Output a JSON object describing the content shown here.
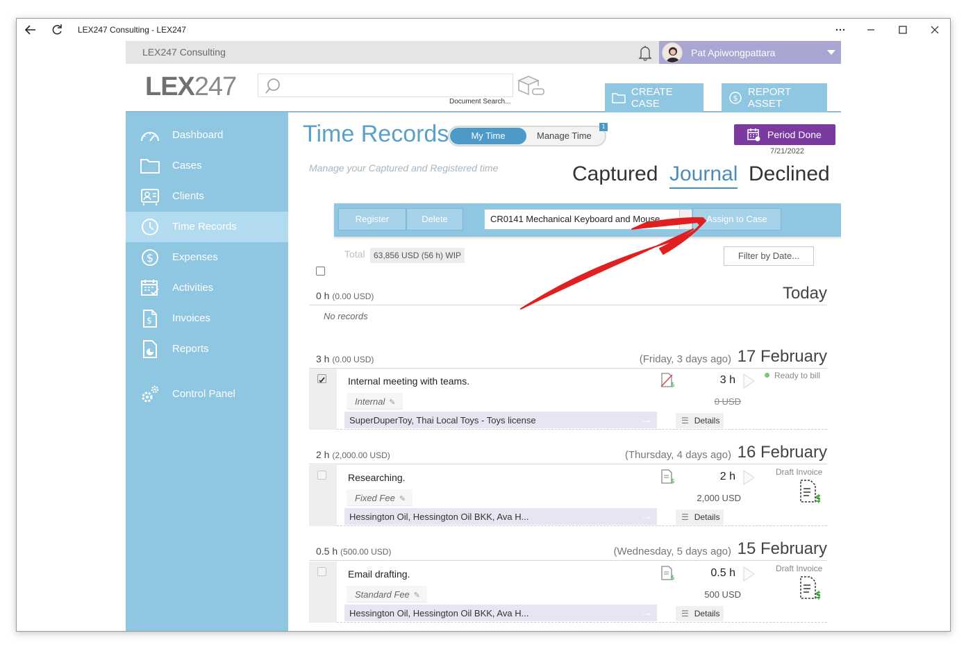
{
  "window": {
    "title": "LEX247 Consulting - LEX247"
  },
  "topbar": {
    "org": "LEX247 Consulting",
    "user": "Pat Apiwongpattara"
  },
  "header": {
    "logo_lex": "LEX",
    "logo_num": "247",
    "search_placeholder": "",
    "search_caption": "Document Search...",
    "create_case": "CREATE CASE",
    "report_asset": "REPORT ASSET"
  },
  "sidebar": {
    "items": [
      {
        "label": "Dashboard",
        "icon": "dashboard-icon"
      },
      {
        "label": "Cases",
        "icon": "folder-icon"
      },
      {
        "label": "Clients",
        "icon": "clients-icon"
      },
      {
        "label": "Time Records",
        "icon": "clock-icon",
        "active": true
      },
      {
        "label": "Expenses",
        "icon": "dollar-icon"
      },
      {
        "label": "Activities",
        "icon": "calendar-icon"
      },
      {
        "label": "Invoices",
        "icon": "invoice-icon"
      },
      {
        "label": "Reports",
        "icon": "report-icon"
      },
      {
        "label": "Control Panel",
        "icon": "gears-icon"
      }
    ]
  },
  "main": {
    "title": "Time Records",
    "toggle": {
      "my_time": "My Time",
      "manage_time": "Manage Time",
      "badge": "1"
    },
    "period_done": "Period Done",
    "period_date": "7/21/2022",
    "subtitle": "Manage your Captured and Registered time",
    "tabs": {
      "captured": "Captured",
      "journal": "Journal",
      "declined": "Declined",
      "active": "Journal"
    },
    "toolbar": {
      "register": "Register",
      "delete": "Delete",
      "case_selected": "CR0141 Mechanical Keyboard and Mouse",
      "assign": "Assign to Case"
    },
    "total_label": "Total",
    "total_value": "63,856 USD (56 h)  WIP",
    "filter_placeholder": "Filter by Date...",
    "days": [
      {
        "hours": "0 h",
        "amount": "(0.00 USD)",
        "relative": "",
        "date": "Today",
        "empty_text": "No records"
      },
      {
        "hours": "3 h",
        "amount": "(0.00 USD)",
        "relative": "(Friday, 3 days ago)",
        "date": "17 February"
      },
      {
        "hours": "2 h",
        "amount": "(2,000.00 USD)",
        "relative": "(Thursday, 4 days ago)",
        "date": "16 February"
      },
      {
        "hours": "0.5 h",
        "amount": "(500.00 USD)",
        "relative": "(Wednesday, 5 days ago)",
        "date": "15 February"
      }
    ],
    "entries": [
      {
        "description": "Internal meeting with teams.",
        "type": "Internal",
        "client": "SuperDuperToy, Thai Local Toys - Toys license",
        "hours": "3 h",
        "amount": "0 USD",
        "status": "Ready to bill",
        "details": "Details",
        "checked": true
      },
      {
        "description": "Researching.",
        "type": "Fixed Fee",
        "client": "Hessington Oil, Hessington Oil BKK, Ava H...",
        "hours": "2 h",
        "amount": "2,000 USD",
        "status": "Draft Invoice",
        "details": "Details",
        "checked": false
      },
      {
        "description": "Email drafting.",
        "type": "Standard Fee",
        "client": "Hessington Oil, Hessington Oil BKK, Ava H...",
        "hours": "0.5 h",
        "amount": "500 USD",
        "status": "Draft Invoice",
        "details": "Details",
        "checked": false
      }
    ]
  },
  "colors": {
    "accent": "#8fc6e2",
    "title": "#5aa0c8",
    "purple": "#7b3aa0",
    "user_bar": "#a8a6d3",
    "annotation": "#e02020"
  }
}
